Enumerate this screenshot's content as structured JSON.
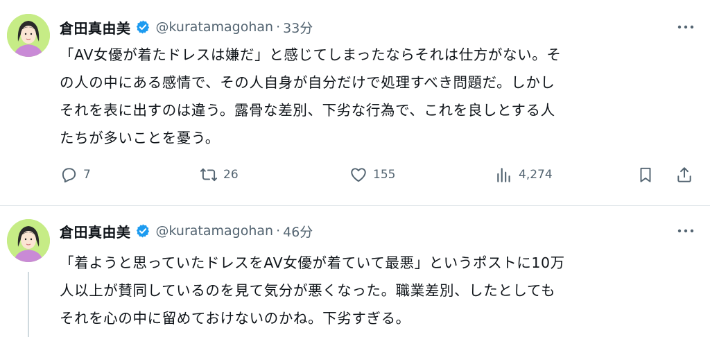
{
  "tweets": [
    {
      "name": "倉田真由美",
      "handle": "@kuratamagohan",
      "separator": "·",
      "time": "33分",
      "lines": [
        "「AV女優が着たドレスは嫌だ」と感じてしまったならそれは仕方がない。そ",
        "の人の中にある感情で、その人自身が自分だけで処理すべき問題だ。しかし",
        "それを表に出すのは違う。露骨な差別、下劣な行為で、これを良しとする人",
        "たちが多いことを憂う。"
      ],
      "replies": "7",
      "reposts": "26",
      "likes": "155",
      "views": "4,274"
    },
    {
      "name": "倉田真由美",
      "handle": "@kuratamagohan",
      "separator": "·",
      "time": "46分",
      "lines": [
        "「着ようと思っていたドレスをAV女優が着ていて最悪」というポストに10万",
        "人以上が賛同しているのを見て気分が悪くなった。職業差別、したとしても",
        "それを心の中に留めておけないのかね。下劣すぎる。"
      ]
    }
  ],
  "colors": {
    "text": "#0f1419",
    "secondary": "#536471",
    "verified": "#1d9bf0",
    "avatar_bg": "#c6ec86"
  }
}
